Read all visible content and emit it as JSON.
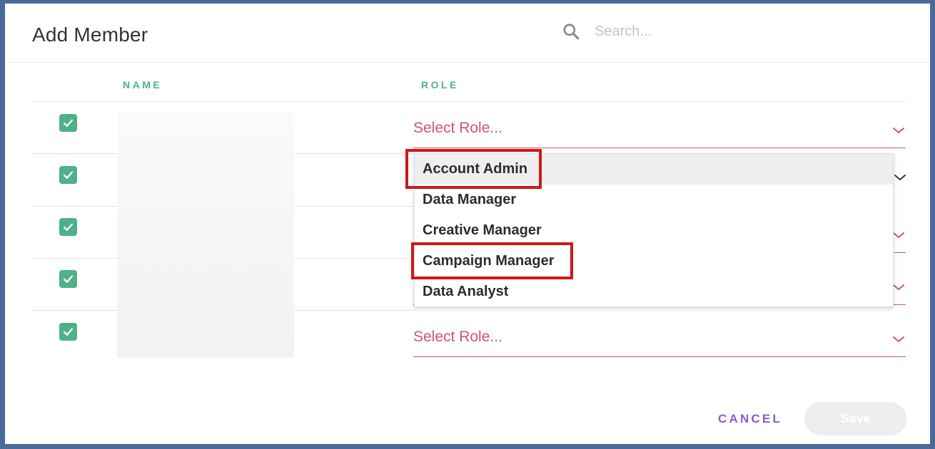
{
  "modal": {
    "title": "Add Member",
    "search": {
      "placeholder": "Search..."
    }
  },
  "table": {
    "columns": [
      "NAME",
      "ROLE"
    ],
    "rows": [
      {
        "checked": true,
        "role_value": "Select Role..."
      },
      {
        "checked": true,
        "role_value": ""
      },
      {
        "checked": true,
        "role_value": ""
      },
      {
        "checked": true,
        "role_value": ""
      },
      {
        "checked": true,
        "role_value": "Select Role..."
      }
    ]
  },
  "dropdown": {
    "options": [
      "Account Admin",
      "Data Manager",
      "Creative Manager",
      "Campaign Manager",
      "Data Analyst"
    ],
    "highlighted": "Account Admin",
    "callouts": [
      "Account Admin",
      "Campaign Manager"
    ]
  },
  "footer": {
    "cancel_label": "CANCEL",
    "save_label": "Save"
  },
  "colors": {
    "accent_green": "#4eb18a",
    "role_red": "#d3546b",
    "cancel_purple": "#8a5dc2",
    "callout_red": "#d0161b"
  }
}
